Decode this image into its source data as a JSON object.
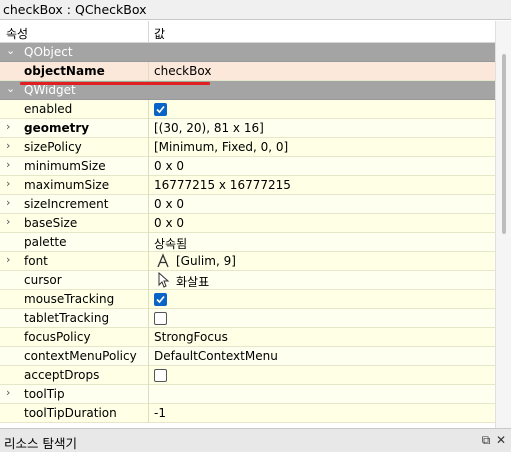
{
  "window": {
    "title": "checkBox : QCheckBox"
  },
  "columns": {
    "property": "속성",
    "value": "값"
  },
  "groups": {
    "qobject": "QObject",
    "qwidget": "QWidget"
  },
  "rows": {
    "objectName": {
      "name": "objectName",
      "value": "checkBox"
    },
    "enabled": {
      "name": "enabled",
      "checked": true
    },
    "geometry": {
      "name": "geometry",
      "value": "[(30, 20), 81 x 16]"
    },
    "sizePolicy": {
      "name": "sizePolicy",
      "value": "[Minimum, Fixed, 0, 0]"
    },
    "minimumSize": {
      "name": "minimumSize",
      "value": "0 x 0"
    },
    "maximumSize": {
      "name": "maximumSize",
      "value": "16777215 x 16777215"
    },
    "sizeIncrement": {
      "name": "sizeIncrement",
      "value": "0 x 0"
    },
    "baseSize": {
      "name": "baseSize",
      "value": "0 x 0"
    },
    "palette": {
      "name": "palette",
      "value": "상속됨"
    },
    "font": {
      "name": "font",
      "value": "[Gulim, 9]"
    },
    "cursor": {
      "name": "cursor",
      "value": "화살표"
    },
    "mouseTracking": {
      "name": "mouseTracking",
      "checked": true
    },
    "tabletTracking": {
      "name": "tabletTracking",
      "checked": false
    },
    "focusPolicy": {
      "name": "focusPolicy",
      "value": "StrongFocus"
    },
    "contextMenuPolicy": {
      "name": "contextMenuPolicy",
      "value": "DefaultContextMenu"
    },
    "acceptDrops": {
      "name": "acceptDrops",
      "checked": false
    },
    "toolTip": {
      "name": "toolTip",
      "value": ""
    },
    "toolTipDuration": {
      "name": "toolTipDuration",
      "value": "-1"
    }
  },
  "bottom_panel": {
    "title": "리소스 탐색기"
  },
  "colors": {
    "group_bg": "#a4a4a4",
    "row_bg": "#ffffe6",
    "highlight_row": "#fce8da",
    "underline": "#e02020",
    "checkbox_on": "#0a64c8"
  }
}
